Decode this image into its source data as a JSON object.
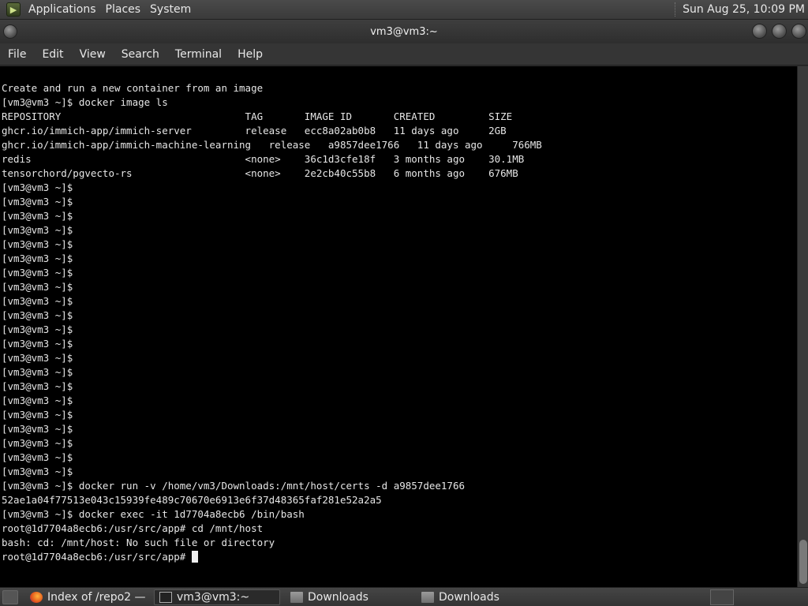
{
  "top_panel": {
    "menus": [
      "Applications",
      "Places",
      "System"
    ],
    "clock": "Sun Aug 25, 10:09 PM"
  },
  "window": {
    "title": "vm3@vm3:~"
  },
  "menubar": {
    "items": [
      "File",
      "Edit",
      "View",
      "Search",
      "Terminal",
      "Help"
    ]
  },
  "terminal": {
    "lines": [
      "Create and run a new container from an image",
      "[vm3@vm3 ~]$ docker image ls",
      "REPOSITORY                               TAG       IMAGE ID       CREATED         SIZE",
      "ghcr.io/immich-app/immich-server         release   ecc8a02ab0b8   11 days ago     2GB",
      "ghcr.io/immich-app/immich-machine-learning   release   a9857dee1766   11 days ago     766MB",
      "redis                                    <none>    36c1d3cfe18f   3 months ago    30.1MB",
      "tensorchord/pgvecto-rs                   <none>    2e2cb40c55b8   6 months ago    676MB",
      "[vm3@vm3 ~]$",
      "[vm3@vm3 ~]$",
      "[vm3@vm3 ~]$",
      "[vm3@vm3 ~]$",
      "[vm3@vm3 ~]$",
      "[vm3@vm3 ~]$",
      "[vm3@vm3 ~]$",
      "[vm3@vm3 ~]$",
      "[vm3@vm3 ~]$",
      "[vm3@vm3 ~]$",
      "[vm3@vm3 ~]$",
      "[vm3@vm3 ~]$",
      "[vm3@vm3 ~]$",
      "[vm3@vm3 ~]$",
      "[vm3@vm3 ~]$",
      "[vm3@vm3 ~]$",
      "[vm3@vm3 ~]$",
      "[vm3@vm3 ~]$",
      "[vm3@vm3 ~]$",
      "[vm3@vm3 ~]$",
      "[vm3@vm3 ~]$",
      "[vm3@vm3 ~]$ docker run -v /home/vm3/Downloads:/mnt/host/certs -d a9857dee1766",
      "52ae1a04f77513e043c15939fe489c70670e6913e6f37d48365faf281e52a2a5",
      "[vm3@vm3 ~]$ docker exec -it 1d7704a8ecb6 /bin/bash",
      "root@1d7704a8ecb6:/usr/src/app# cd /mnt/host",
      "bash: cd: /mnt/host: No such file or directory"
    ],
    "prompt_line": "root@1d7704a8ecb6:/usr/src/app# "
  },
  "taskbar": {
    "tasks": [
      {
        "label": "Index of /repo2 — ...",
        "icon": "firefox-icon",
        "active": false
      },
      {
        "label": "vm3@vm3:~",
        "icon": "terminal-icon",
        "active": true
      },
      {
        "label": "Downloads",
        "icon": "folder-icon",
        "active": false
      },
      {
        "label": "Downloads",
        "icon": "folder-icon",
        "active": false
      }
    ]
  }
}
